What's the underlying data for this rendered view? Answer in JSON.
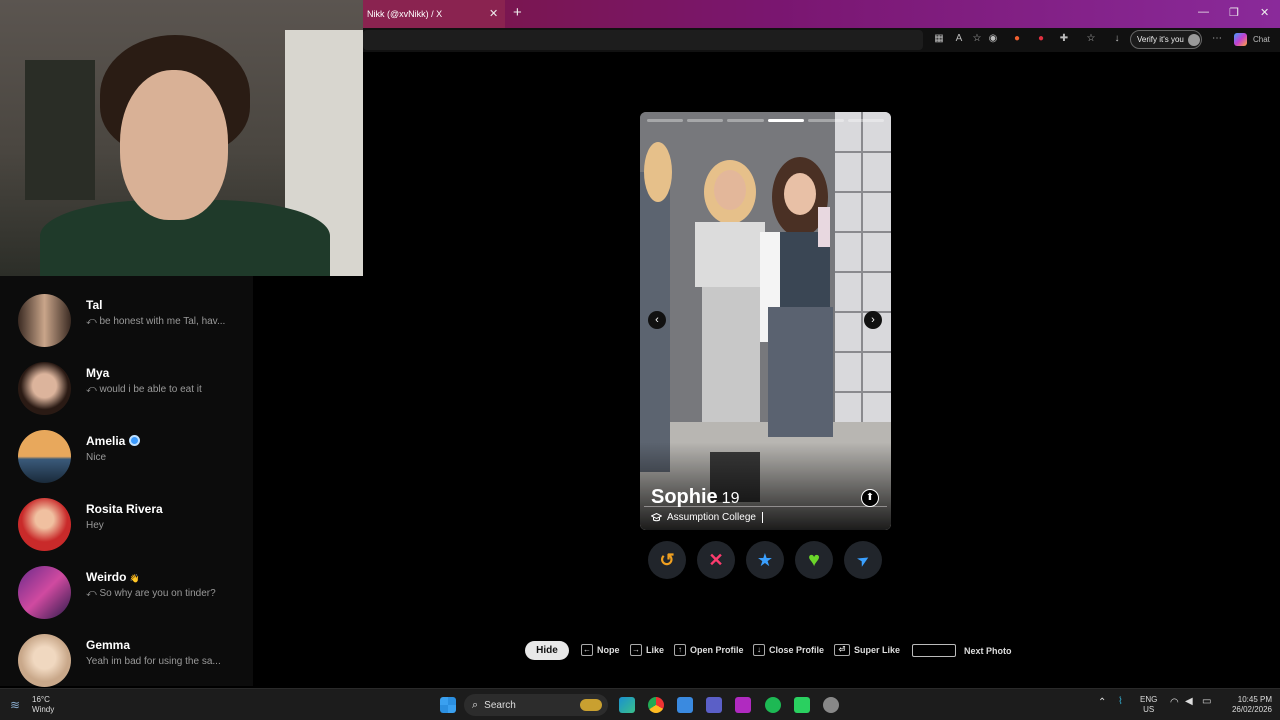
{
  "browser": {
    "tab_title": "Nikk (@xvNikk) / X",
    "tab_close": "✕",
    "new_tab": "+",
    "window_controls": [
      "—",
      "❐",
      "✕"
    ],
    "verify_label": "Verify it's you",
    "chat_label": "Chat"
  },
  "messages": [
    {
      "name": "Tal",
      "preview": "⤺ be honest with me Tal, hav...",
      "avatar_colors": [
        "#3a2a22",
        "#c9a58a"
      ]
    },
    {
      "name": "Mya",
      "preview": "⤺ would i be able to eat it",
      "avatar_colors": [
        "#2a1a14",
        "#dcb49c"
      ]
    },
    {
      "name": "Amelia",
      "preview": "Nice",
      "verified": true,
      "avatar_colors": [
        "#e8a85c",
        "#3a5a7a"
      ]
    },
    {
      "name": "Rosita Rivera",
      "preview": "Hey",
      "avatar_colors": [
        "#c92a2a",
        "#f0c0a0"
      ]
    },
    {
      "name": "Weirdo",
      "badge": "👋",
      "preview": "⤺ So why are you on tinder?",
      "avatar_colors": [
        "#6a2a8a",
        "#d04aa0"
      ]
    },
    {
      "name": "Gemma",
      "preview": "Yeah im bad for using the sa...",
      "avatar_colors": [
        "#c9a88a",
        "#f0d8c0"
      ]
    }
  ],
  "profile": {
    "name": "Sophie",
    "age": "19",
    "school": "Assumption College",
    "photo_count": 6,
    "current_photo": 4,
    "prev_glyph": "‹",
    "next_glyph": "›",
    "info_glyph": "⬆"
  },
  "actions": [
    {
      "name": "rewind",
      "icon": "rewind-icon",
      "glyph": "↺",
      "color": "#f0a020"
    },
    {
      "name": "nope",
      "icon": "x-icon",
      "glyph": "✕",
      "color": "#fd3c6e"
    },
    {
      "name": "super-like",
      "icon": "star-icon",
      "glyph": "★",
      "color": "#3aa0ff"
    },
    {
      "name": "like",
      "icon": "heart-icon",
      "glyph": "♥",
      "color": "#6bd62a"
    },
    {
      "name": "boost",
      "icon": "send-icon",
      "glyph": "➤",
      "color": "#3aa0ff"
    }
  ],
  "hints": {
    "hide_label": "Hide",
    "items": [
      {
        "key": "←",
        "label": "Nope"
      },
      {
        "key": "→",
        "label": "Like"
      },
      {
        "key": "↑",
        "label": "Open Profile"
      },
      {
        "key": "↓",
        "label": "Close Profile"
      },
      {
        "key": "⏎",
        "label": "Super Like"
      },
      {
        "key": "",
        "label": "Next Photo"
      }
    ]
  },
  "taskbar": {
    "temperature": "16°C",
    "weather": "Windy",
    "search_placeholder": "Search",
    "language_top": "ENG",
    "language_bottom": "US",
    "time": "10:45 PM",
    "date": "26/02/2026"
  }
}
